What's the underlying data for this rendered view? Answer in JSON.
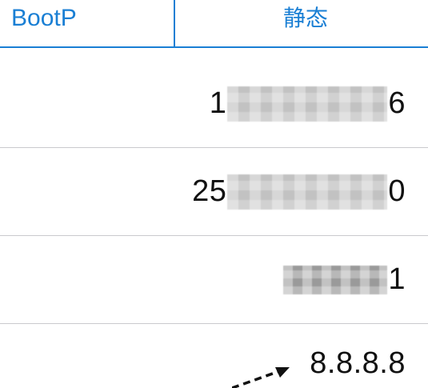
{
  "segmented": {
    "bootp_label": "BootP",
    "static_label": "静态"
  },
  "rows": [
    {
      "prefix": "1",
      "suffix": "6"
    },
    {
      "prefix": "25",
      "suffix": "0"
    },
    {
      "prefix": "",
      "suffix": "1"
    },
    {
      "value": "8.8.8.8"
    }
  ],
  "colors": {
    "accent": "#1a7fd4",
    "separator": "#c9c9ce"
  }
}
